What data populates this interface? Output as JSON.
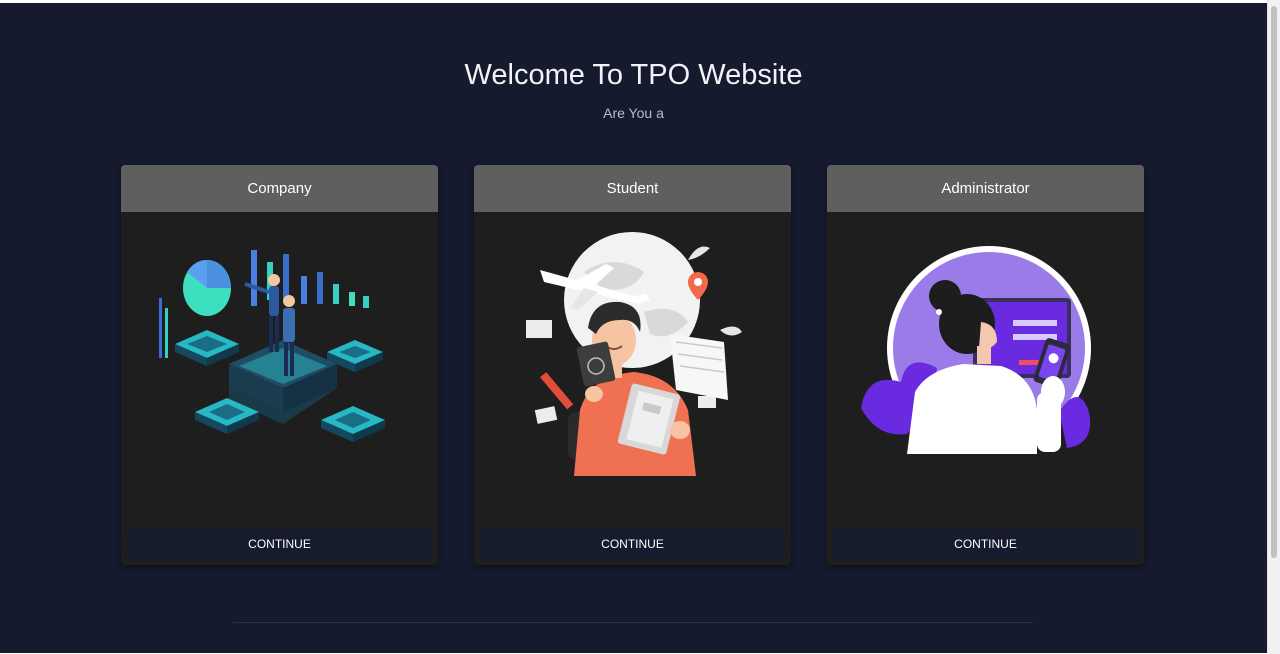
{
  "page": {
    "title": "Welcome To TPO Website",
    "subtitle": "Are You a"
  },
  "cards": [
    {
      "label": "Company",
      "button": "CONTINUE",
      "illustration": "business-analytics-illustration"
    },
    {
      "label": "Student",
      "button": "CONTINUE",
      "illustration": "student-travel-illustration"
    },
    {
      "label": "Administrator",
      "button": "CONTINUE",
      "illustration": "admin-login-illustration"
    }
  ],
  "colors": {
    "background": "#151a2e",
    "card": "#1e1e1e",
    "card_header": "#5f5f5f",
    "button": "#161b2e"
  }
}
